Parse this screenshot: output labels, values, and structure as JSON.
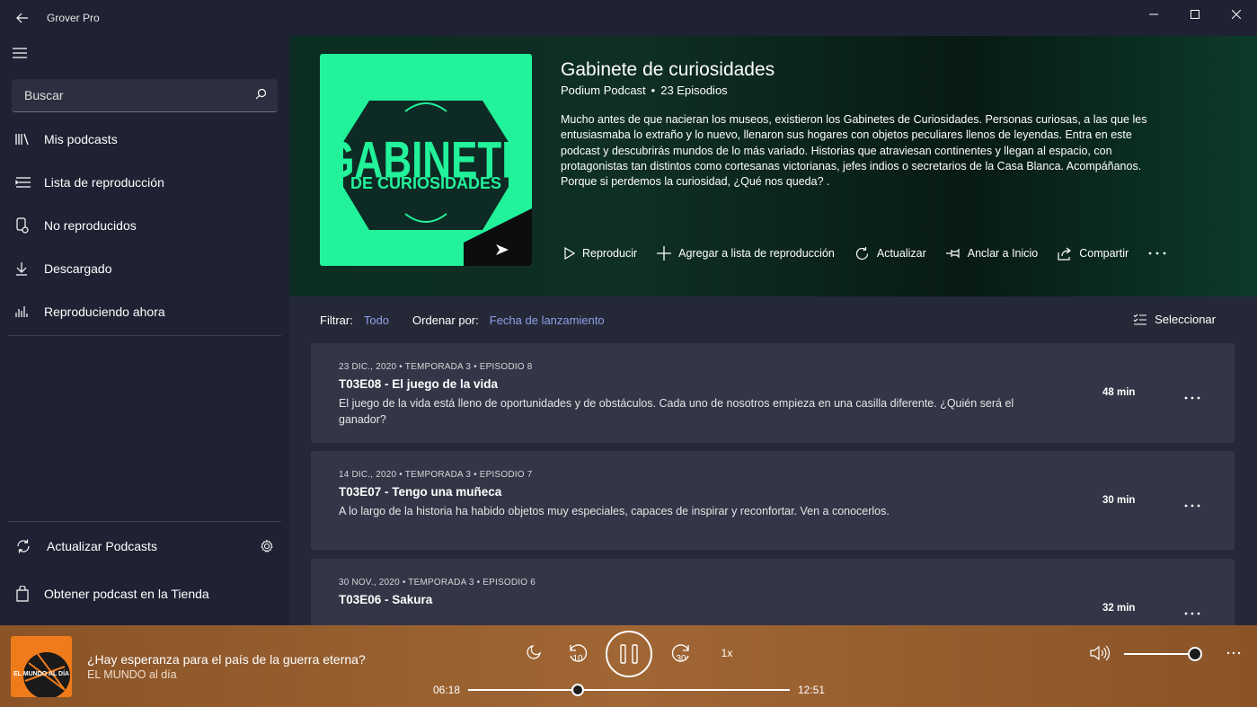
{
  "app": {
    "title": "Grover Pro"
  },
  "sidebar": {
    "search_placeholder": "Buscar",
    "items": [
      {
        "label": "Mis podcasts",
        "icon": "library-icon"
      },
      {
        "label": "Lista de reproducción",
        "icon": "playlist-icon"
      },
      {
        "label": "No reproducidos",
        "icon": "unplayed-icon"
      },
      {
        "label": "Descargado",
        "icon": "download-icon"
      },
      {
        "label": "Reproduciendo ahora",
        "icon": "equalizer-icon"
      }
    ],
    "footer": {
      "refresh_label": "Actualizar Podcasts",
      "store_label": "Obtener podcast en la Tienda"
    }
  },
  "podcast": {
    "title": "Gabinete de curiosidades",
    "publisher": "Podium Podcast",
    "episodes_count": "23 Episodios",
    "cover_line1": "GABINETE",
    "cover_line2": "DE CURIOSIDADES",
    "description": "Mucho antes de que nacieran los museos, existieron los Gabinetes de Curiosidades. Personas curiosas, a las que les entusiasmaba lo extraño y lo nuevo, llenaron sus hogares con objetos peculiares llenos de leyendas. Entra en este podcast y descubrirás mundos de lo más variado. Historias que atraviesan continentes y llegan al espacio, con protagonistas tan distintos como cortesanas victorianas, jefes indios o secretarios de la Casa Blanca. Acompáñanos. Porque si perdemos la curiosidad, ¿Qué nos queda? .",
    "actions": {
      "play": "Reproducir",
      "add_playlist": "Agregar a lista de reproducción",
      "refresh": "Actualizar",
      "pin": "Anclar a Inicio",
      "share": "Compartir"
    }
  },
  "filters": {
    "filter_label": "Filtrar:",
    "filter_value": "Todo",
    "sort_label": "Ordenar por:",
    "sort_value": "Fecha de lanzamiento",
    "select_label": "Seleccionar"
  },
  "episodes": [
    {
      "meta": "23 DIC., 2020  •  TEMPORADA 3  •  EPISODIO 8",
      "title": "T03E08 - El juego de la vida",
      "description": "El juego de la vida está lleno de oportunidades y de obstáculos. Cada uno de nosotros empieza en una casilla diferente. ¿Quién será el ganador?",
      "duration": "48 min"
    },
    {
      "meta": "14 DIC., 2020  •  TEMPORADA 3  •  EPISODIO 7",
      "title": "T03E07 - Tengo una muñeca",
      "description": "A lo largo de la historia ha habido objetos muy especiales, capaces de inspirar y reconfortar. Ven a conocerlos.",
      "duration": "30 min"
    },
    {
      "meta": "30 NOV., 2020  •  TEMPORADA 3  •  EPISODIO 6",
      "title": "T03E06 - Sakura",
      "description": "",
      "duration": "32 min"
    }
  ],
  "player": {
    "title": "¿Hay esperanza para el país de la guerra eterna?",
    "show": "EL MUNDO al día",
    "thumb_text": "EL MUNDO AL DÍA",
    "elapsed": "06:18",
    "total": "12:51",
    "progress": 0.34,
    "rewind_seconds": "10",
    "forward_seconds": "30",
    "speed": "1x",
    "volume": 0.85,
    "colors": {
      "background": "#9a6030",
      "accent": "#ffffff"
    }
  }
}
